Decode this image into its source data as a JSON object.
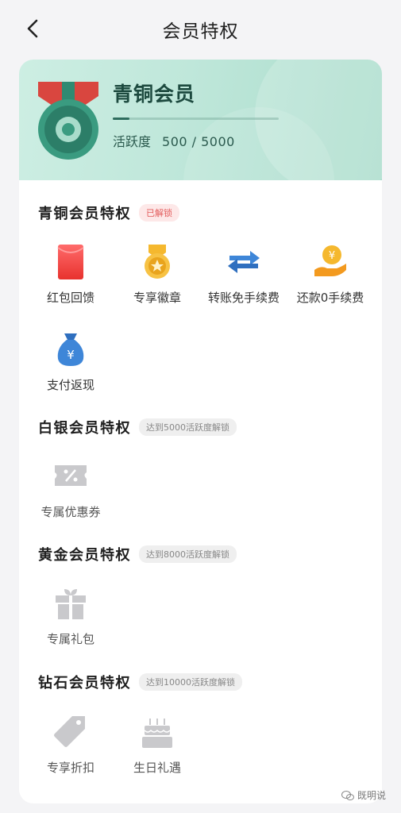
{
  "nav": {
    "title": "会员特权"
  },
  "banner": {
    "tier": "青铜会员",
    "activity_label": "活跃度",
    "activity_value": "500 / 5000",
    "progress": 0.1
  },
  "sections": [
    {
      "title": "青铜会员特权",
      "tag": "已解锁",
      "items": [
        {
          "label": "红包回馈",
          "icon": "red-envelope-icon"
        },
        {
          "label": "专享徽章",
          "icon": "medal-badge-icon"
        },
        {
          "label": "转账免手续费",
          "icon": "transfer-arrows-icon"
        },
        {
          "label": "还款0手续费",
          "icon": "hand-coin-icon"
        },
        {
          "label": "支付返现",
          "icon": "money-bag-icon"
        }
      ]
    },
    {
      "title": "白银会员特权",
      "tag": "达到5000活跃度解锁",
      "items": [
        {
          "label": "专属优惠券",
          "icon": "coupon-icon"
        }
      ]
    },
    {
      "title": "黄金会员特权",
      "tag": "达到8000活跃度解锁",
      "items": [
        {
          "label": "专属礼包",
          "icon": "gift-icon"
        }
      ]
    },
    {
      "title": "钻石会员特权",
      "tag": "达到10000活跃度解锁",
      "items": [
        {
          "label": "专享折扣",
          "icon": "discount-tag-icon"
        },
        {
          "label": "生日礼遇",
          "icon": "birthday-cake-icon"
        }
      ]
    }
  ],
  "watermark": "既明说"
}
